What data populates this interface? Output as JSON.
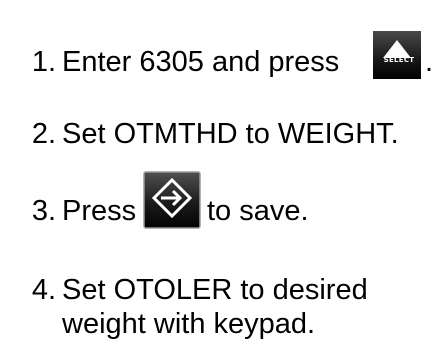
{
  "steps": [
    {
      "number": "1.",
      "text": "Enter 6305 and press",
      "suffix": "."
    },
    {
      "number": "2.",
      "text": "Set OTMTHD to WEIGHT."
    },
    {
      "number": "3.",
      "text_before": "Press",
      "text_after": "to save."
    },
    {
      "number": "4.",
      "line1": "Set OTOLER to desired",
      "line2": "weight with keypad."
    }
  ],
  "keys": {
    "select_label": "SELECT",
    "select_icon": "up-triangle-icon",
    "enter_icon": "enter-arrow-icon"
  },
  "colors": {
    "text": "#000000",
    "key_face": "#1a1a1a",
    "key_glyph": "#ffffff"
  }
}
